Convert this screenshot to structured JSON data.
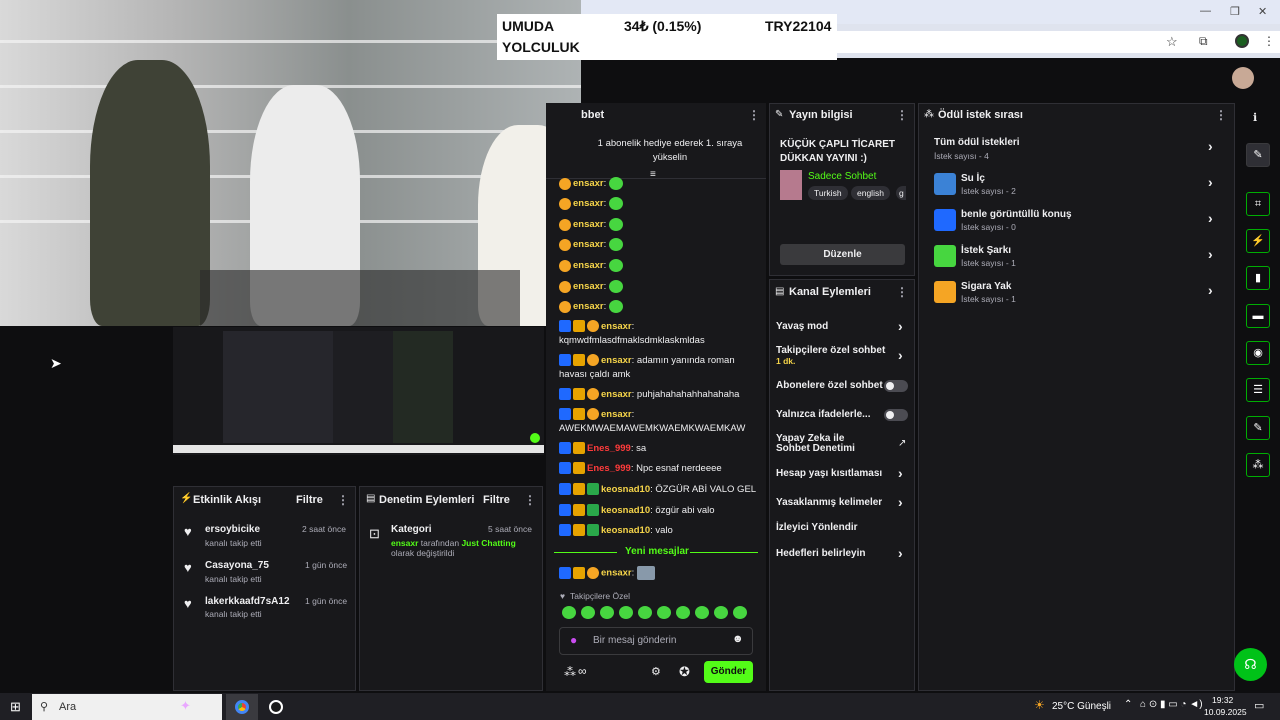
{
  "ticker": {
    "name": "UMUDA YOLCULUK",
    "line1": "UMUDA",
    "line2": "YOLCULUK",
    "change": "34₺ (0.15%)",
    "total": "TRY22104"
  },
  "chat": {
    "title": "bbet",
    "pinned": "1 abonelik hediye ederek 1. sıraya yükselin",
    "messages": [
      {
        "user": "ensaxr",
        "text": ""
      },
      {
        "user": "ensaxr",
        "text": ""
      },
      {
        "user": "ensaxr",
        "text": ""
      },
      {
        "user": "ensaxr",
        "text": ""
      },
      {
        "user": "ensaxr",
        "text": ""
      },
      {
        "user": "ensaxr",
        "text": ""
      },
      {
        "user": "ensaxr",
        "text": ""
      },
      {
        "user": "ensaxr",
        "text": "kqmwdfmlasdfmaklsdmklaskmldas"
      },
      {
        "user": "ensaxr",
        "text": "adamın yanında roman havası çaldı amk"
      },
      {
        "user": "ensaxr",
        "text": "puhjahahahahhahahaha"
      },
      {
        "user": "ensaxr",
        "text": "AWEKMWAEMAWEMKWAEMKWAEMKAW"
      },
      {
        "user": "Enes_999",
        "text": "sa"
      },
      {
        "user": "Enes_999",
        "text": "Npc esnaf nerdeeee"
      },
      {
        "user": "keosnad10",
        "text": "ÖZGÜR ABİ VALO GEL"
      },
      {
        "user": "keosnad10",
        "text": "özgür abi valo"
      },
      {
        "user": "keosnad10",
        "text": "valo"
      }
    ],
    "new_messages": "Yeni mesajlar",
    "last_user": "ensaxr",
    "followers_only": "Takipçilere Özel",
    "input_placeholder": "Bir mesaj gönderin",
    "send": "Gönder",
    "points": "∞"
  },
  "stream_info": {
    "title": "Yayın bilgisi",
    "stream_title": "KÜÇÜK ÇAPLI TİCARET DÜKKAN YAYINI :)",
    "category": "Sadece Sohbet",
    "tags": [
      "Turkish",
      "english",
      "g"
    ],
    "edit": "Düzenle"
  },
  "channel_actions": {
    "title": "Kanal Eylemleri",
    "items": [
      {
        "label": "Yavaş mod",
        "sub": ""
      },
      {
        "label": "Takipçilere özel sohbet",
        "sub": "1 dk."
      },
      {
        "label": "Abonelere özel sohbet",
        "sub": ""
      },
      {
        "label": "Yalnızca ifadelerle...",
        "sub": ""
      },
      {
        "label": "Yapay Zeka ile Sohbet Denetimi",
        "sub": ""
      },
      {
        "label": "Hesap yaşı kısıtlaması",
        "sub": ""
      },
      {
        "label": "Yasaklanmış kelimeler",
        "sub": ""
      },
      {
        "label": "İzleyici Yönlendir",
        "sub": ""
      },
      {
        "label": "Hedefleri belirleyin",
        "sub": ""
      }
    ]
  },
  "rewards": {
    "title": "Ödül istek sırası",
    "items": [
      {
        "label": "Tüm ödül istekleri",
        "count": "İstek sayısı - 4"
      },
      {
        "label": "Su İç",
        "count": "İstek sayısı - 2"
      },
      {
        "label": "benle görüntüllü konuş",
        "count": "İstek sayısı - 0"
      },
      {
        "label": "İstek Şarkı",
        "count": "İstek sayısı - 1"
      },
      {
        "label": "Sigara Yak",
        "count": "İstek sayısı - 1"
      }
    ]
  },
  "activity": {
    "title": "Etkinlik Akışı",
    "filter": "Filtre",
    "items": [
      {
        "user": "ersoybicike",
        "action": "kanalı takip etti",
        "time": "2 saat önce"
      },
      {
        "user": "Casayona_75",
        "action": "kanalı takip etti",
        "time": "1 gün önce"
      },
      {
        "user": "lakerkkaafd7sA12",
        "action": "kanalı takip etti",
        "time": "1 gün önce"
      }
    ]
  },
  "moderation": {
    "title": "Denetim Eylemleri",
    "filter": "Filtre",
    "item": {
      "label": "Kategori",
      "time": "5 saat önce",
      "user": "ensaxr",
      "middle": "tarafından",
      "category": "Just Chatting",
      "suffix": "olarak değiştirildi"
    }
  },
  "taskbar": {
    "search": "Ara",
    "weather": "25°C  Güneşli",
    "time": "19:32",
    "date": "10.09.2025"
  },
  "colors": {
    "accent": "#53fc18",
    "brand_green": "#00ad03",
    "bg": "#0e0e10",
    "panel": "#18181b"
  }
}
